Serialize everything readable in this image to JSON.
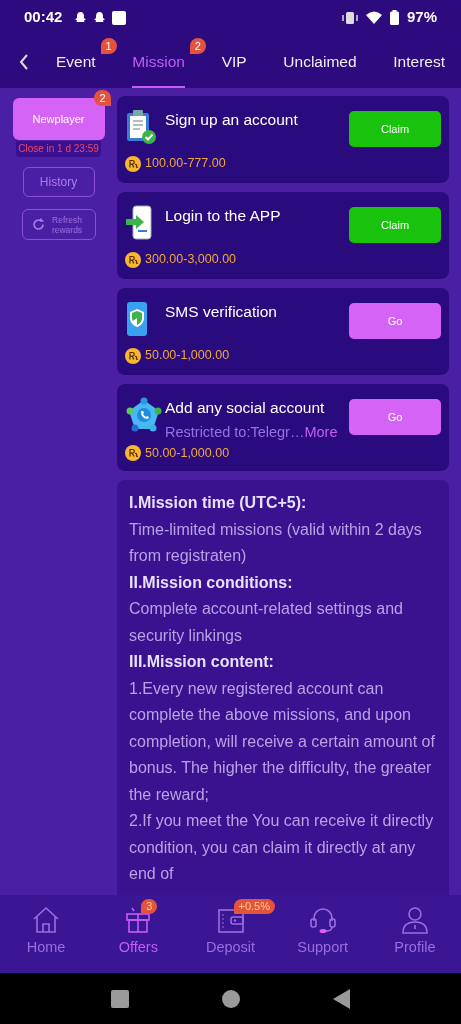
{
  "status_bar": {
    "time": "00:42",
    "battery": "97%"
  },
  "tabs": [
    {
      "label": "Event",
      "badge": "1",
      "selected": false
    },
    {
      "label": "Mission",
      "badge": "2",
      "selected": true
    },
    {
      "label": "VIP",
      "selected": false
    },
    {
      "label": "Unclaimed",
      "selected": false
    },
    {
      "label": "Interest",
      "selected": false
    }
  ],
  "sidebar": {
    "categories": [
      {
        "label": "Newplayer",
        "badge": "2",
        "countdown": "Close in 1 d 23:59",
        "selected": true
      }
    ],
    "history_button": "History",
    "refresh_button": "Refresh rewards"
  },
  "missions": [
    {
      "title": "Sign up an account",
      "reward": "100.00-777.00",
      "action": {
        "kind": "claim",
        "label": "Claim"
      }
    },
    {
      "title": "Login to the APP",
      "reward": "300.00-3,000.00",
      "action": {
        "kind": "claim",
        "label": "Claim"
      }
    },
    {
      "title": "SMS verification",
      "reward": "50.00-1,000.00",
      "action": {
        "kind": "go",
        "label": "Go"
      }
    },
    {
      "title": "Add any social account",
      "subtitle": "Restricted to:Telegr…",
      "more": "More",
      "reward": "50.00-1,000.00",
      "action": {
        "kind": "go",
        "label": "Go"
      }
    }
  ],
  "rules": [
    {
      "kind": "heading",
      "text": "I.Mission time (UTC+5):"
    },
    {
      "kind": "text",
      "text": "Time-limited missions (valid within 2 days from registraten)"
    },
    {
      "kind": "heading",
      "text": "II.Mission conditions:"
    },
    {
      "kind": "text",
      "text": "Complete account-related settings and security linkings"
    },
    {
      "kind": "heading",
      "text": "III.Mission content:"
    },
    {
      "kind": "text",
      "text": "1.Every new registered account can complete the above missions, and upon completion, will receive a certain amount of bonus. The higher the difficulty, the greater the reward;"
    },
    {
      "kind": "text",
      "text": "2.If you meet the You can receive it directly condition, you can claim it directly at any end of"
    }
  ],
  "bottom_nav": [
    {
      "label": "Home",
      "selected": false
    },
    {
      "label": "Offers",
      "badge": "3",
      "selected": true
    },
    {
      "label": "Deposit",
      "badge": "+0.5%",
      "selected": false
    },
    {
      "label": "Support",
      "selected": false
    },
    {
      "label": "Profile",
      "selected": false
    }
  ]
}
